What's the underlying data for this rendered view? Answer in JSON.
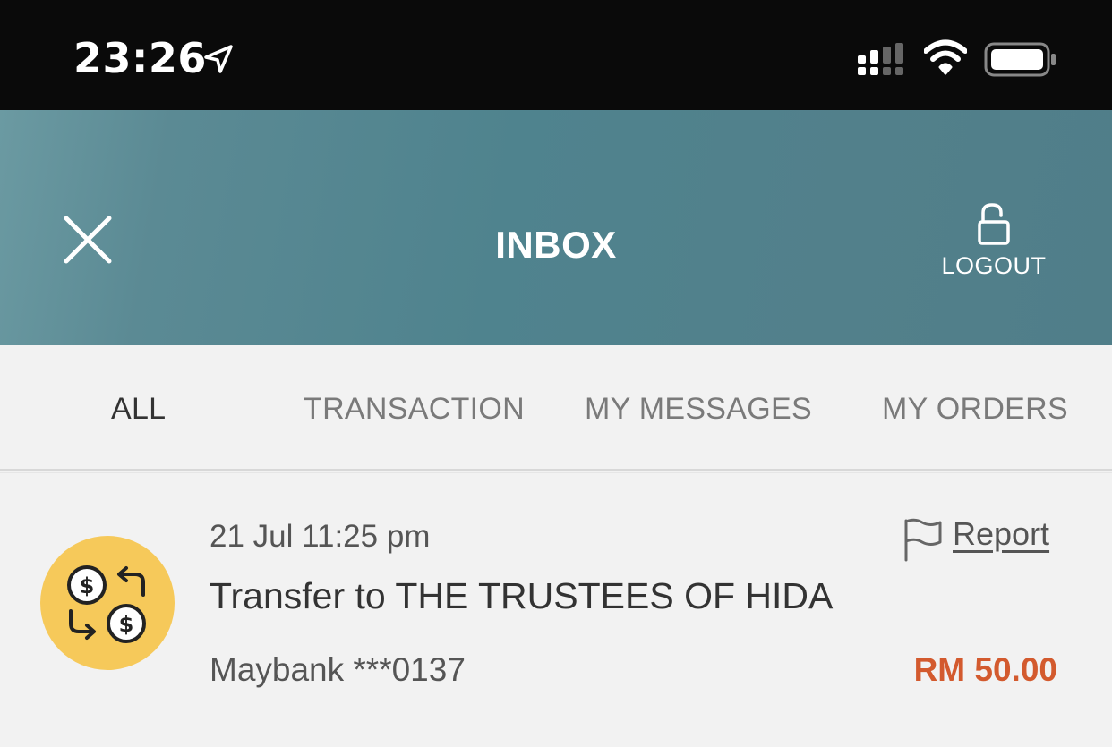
{
  "status_bar": {
    "time": "23:26",
    "icons": [
      "location-arrow-icon",
      "signal-icon",
      "wifi-icon",
      "battery-icon"
    ]
  },
  "header": {
    "title": "INBOX",
    "close_icon": "close-icon",
    "logout_label": "LOGOUT",
    "logout_icon": "unlock-icon"
  },
  "tabs": [
    {
      "label": "ALL",
      "active": true
    },
    {
      "label": "TRANSACTION",
      "active": false
    },
    {
      "label": "MY MESSAGES",
      "active": false
    },
    {
      "label": "MY ORDERS",
      "active": false
    }
  ],
  "messages": [
    {
      "icon": "transfer-icon",
      "date": "21 Jul 11:25 pm",
      "title": "Transfer to THE TRUSTEES OF HIDA",
      "account": "Maybank ***0137",
      "amount": "RM 50.00",
      "report_label": "Report",
      "report_icon": "flag-icon"
    }
  ],
  "colors": {
    "header_teal": "#52838e",
    "amount": "#d35a2e",
    "icon_yellow": "#f6c95a"
  }
}
